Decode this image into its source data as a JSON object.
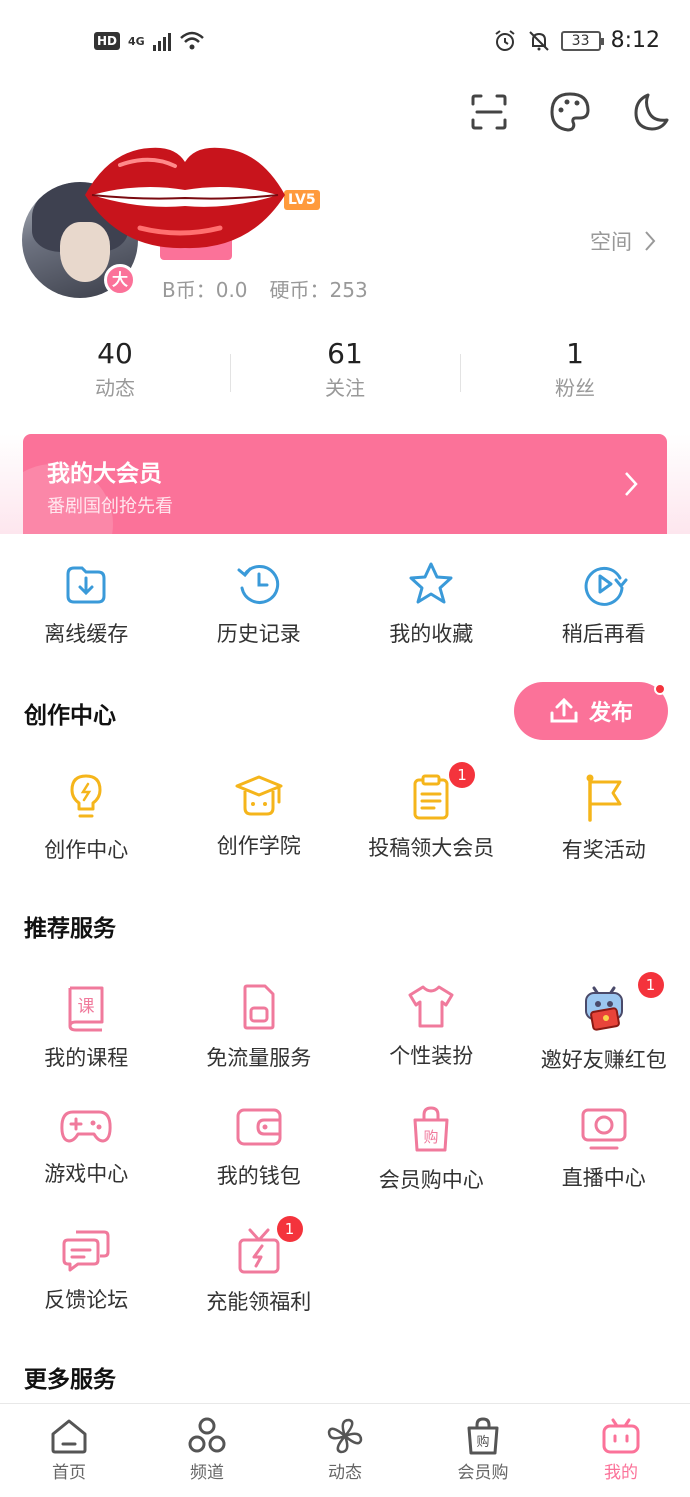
{
  "status_bar": {
    "hd": "HD",
    "network": "4G",
    "battery": "33",
    "time": "8:12"
  },
  "profile": {
    "level_tag": "LV5",
    "vip_badge_char": "大",
    "b_coins": "B币：0.0",
    "coins": "硬币：253",
    "space_link": "空间"
  },
  "stats": [
    {
      "value": "40",
      "label": "动态"
    },
    {
      "value": "61",
      "label": "关注"
    },
    {
      "value": "1",
      "label": "粉丝"
    }
  ],
  "vip_banner": {
    "title": "我的大会员",
    "subtitle": "番剧国创抢先看"
  },
  "quick_actions": [
    {
      "label": "离线缓存",
      "icon": "download-icon"
    },
    {
      "label": "历史记录",
      "icon": "history-icon"
    },
    {
      "label": "我的收藏",
      "icon": "star-icon"
    },
    {
      "label": "稍后再看",
      "icon": "watch-later-icon"
    }
  ],
  "creation": {
    "title": "创作中心",
    "publish_label": "发布",
    "items": [
      {
        "label": "创作中心",
        "icon": "lightbulb-icon",
        "badge": ""
      },
      {
        "label": "创作学院",
        "icon": "graduation-cap-icon",
        "badge": ""
      },
      {
        "label": "投稿领大会员",
        "icon": "clipboard-icon",
        "badge": "1"
      },
      {
        "label": "有奖活动",
        "icon": "flag-icon",
        "badge": ""
      }
    ]
  },
  "recommended": {
    "title": "推荐服务",
    "items": [
      {
        "label": "我的课程",
        "icon": "course-book-icon",
        "badge": "",
        "glyph": "课"
      },
      {
        "label": "免流量服务",
        "icon": "sim-card-icon",
        "badge": ""
      },
      {
        "label": "个性装扮",
        "icon": "tshirt-icon",
        "badge": ""
      },
      {
        "label": "邀好友赚红包",
        "icon": "mascot-red-envelope-icon",
        "badge": "1"
      },
      {
        "label": "游戏中心",
        "icon": "gamepad-icon",
        "badge": ""
      },
      {
        "label": "我的钱包",
        "icon": "wallet-icon",
        "badge": ""
      },
      {
        "label": "会员购中心",
        "icon": "shopping-bag-icon",
        "badge": "",
        "glyph": "购"
      },
      {
        "label": "直播中心",
        "icon": "live-tv-icon",
        "badge": ""
      },
      {
        "label": "反馈论坛",
        "icon": "chat-bubbles-icon",
        "badge": ""
      },
      {
        "label": "充能领福利",
        "icon": "gift-charge-icon",
        "badge": "1"
      }
    ]
  },
  "more_services": {
    "title": "更多服务"
  },
  "bottom_nav": [
    {
      "label": "首页",
      "icon": "home-icon"
    },
    {
      "label": "频道",
      "icon": "channels-icon"
    },
    {
      "label": "动态",
      "icon": "pinwheel-icon"
    },
    {
      "label": "会员购",
      "icon": "shop-bag-icon",
      "glyph": "购"
    },
    {
      "label": "我的",
      "icon": "tv-mascot-icon"
    }
  ],
  "colors": {
    "accent_pink": "#fb7299",
    "blue_icons": "#3a9ad9",
    "yellow_icons": "#f5b51b",
    "badge_red": "#f4333c"
  }
}
